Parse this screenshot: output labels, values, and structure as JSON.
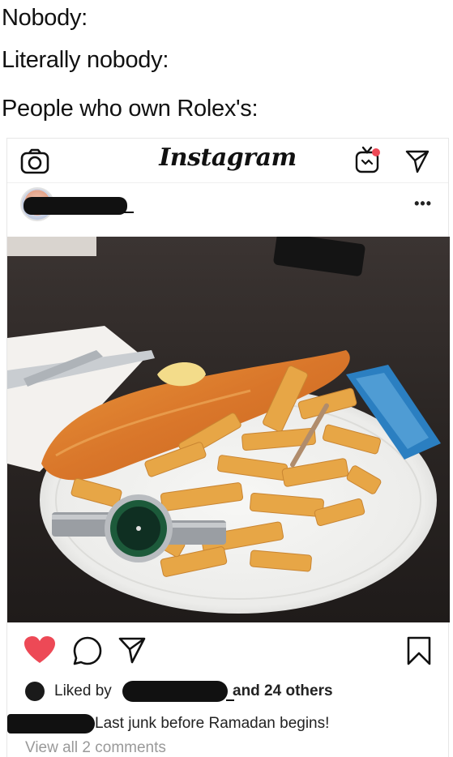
{
  "meme": {
    "line1": "Nobody:",
    "line2": "Literally nobody:",
    "line3": "People who own Rolex's:"
  },
  "instagram": {
    "logo_text": "Instagram",
    "header_icons": [
      "camera-icon",
      "igtv-icon",
      "direct-send-icon"
    ],
    "post": {
      "more_label": "•••",
      "actions": [
        "heart-icon",
        "comment-icon",
        "share-icon",
        "bookmark-icon"
      ],
      "liked_by_label": "Liked by",
      "others_label": "and 24 others",
      "caption_text": "Last junk before Ramadan begins!",
      "view_comments_label": "View all 2 comments"
    }
  },
  "colors": {
    "heart_red": "#ed4956",
    "muted_gray": "#999999",
    "redaction": "#111111"
  }
}
